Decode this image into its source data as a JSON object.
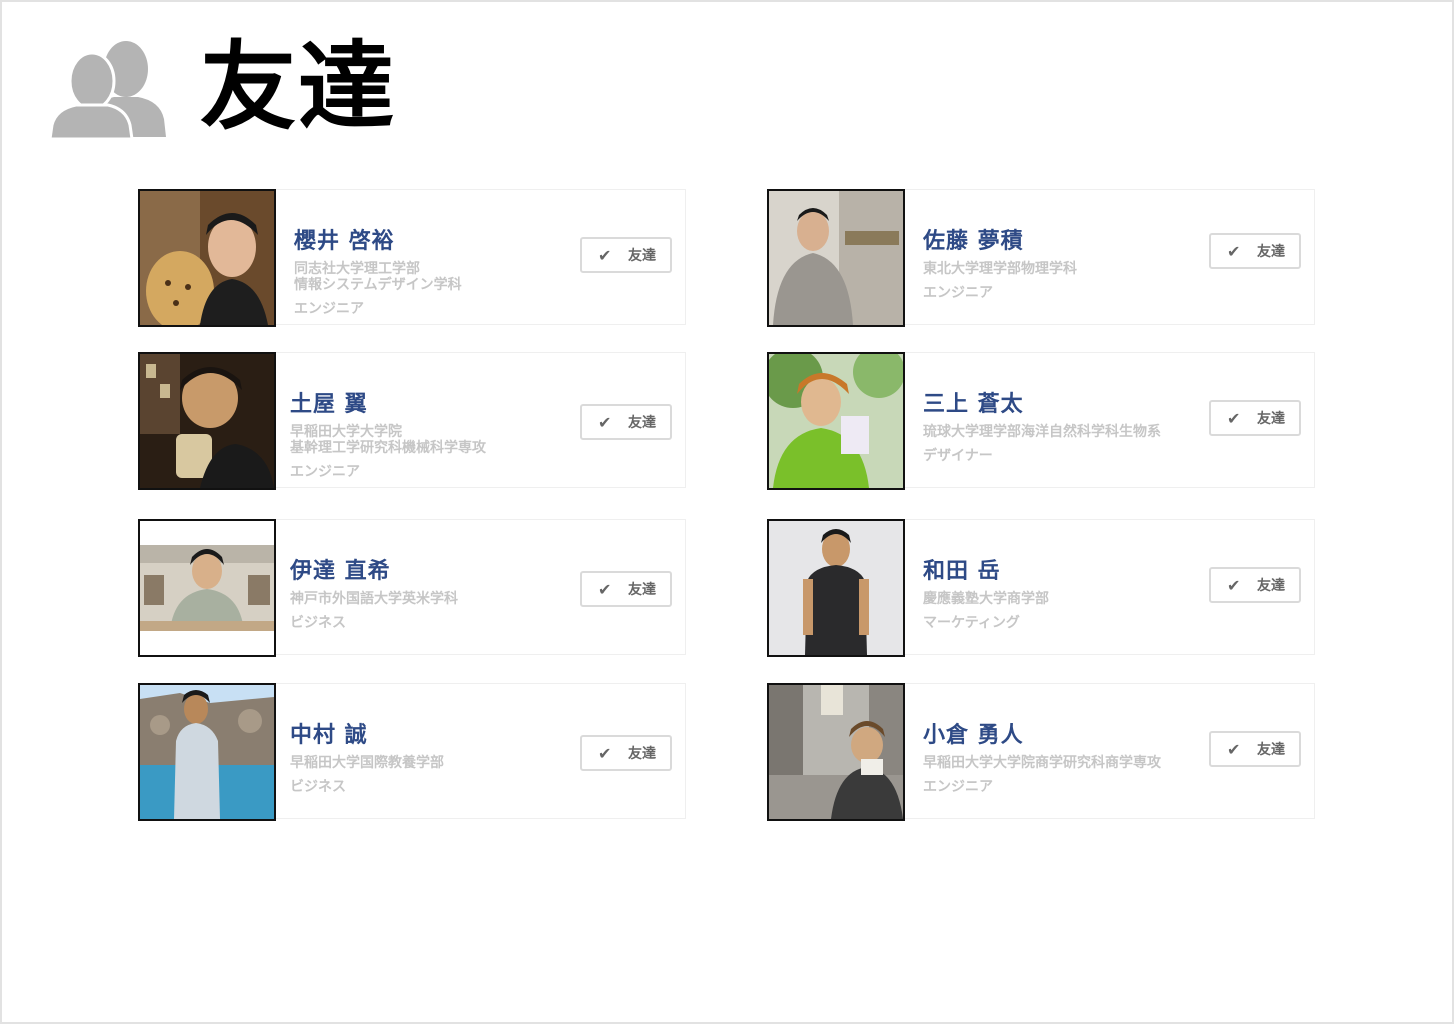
{
  "page": {
    "title": "友達",
    "icon": "people-icon"
  },
  "colors": {
    "name": "#2e4a86",
    "muted": "#c6c6c6",
    "button_border": "#dadada",
    "icon_gray": "#b4b4b4"
  },
  "friends": [
    {
      "name": "櫻井 啓裕",
      "school": [
        "同志社大学理工学部",
        "情報システムデザイン学科"
      ],
      "role": "エンジニア",
      "button_label": "友達",
      "button_icon": "check-icon"
    },
    {
      "name": "佐藤 夢積",
      "school": [
        "東北大学理学部物理学科"
      ],
      "role": "エンジニア",
      "button_label": "友達",
      "button_icon": "check-icon"
    },
    {
      "name": "土屋 翼",
      "school": [
        "早稲田大学大学院",
        "基幹理工学研究科機械科学専攻"
      ],
      "role": "エンジニア",
      "button_label": "友達",
      "button_icon": "check-icon"
    },
    {
      "name": "三上 蒼太",
      "school": [
        "琉球大学理学部海洋自然科学科生物系"
      ],
      "role": "デザイナー",
      "button_label": "友達",
      "button_icon": "check-icon"
    },
    {
      "name": "伊達 直希",
      "school": [
        "神戸市外国語大学英米学科"
      ],
      "role": "ビジネス",
      "button_label": "友達",
      "button_icon": "check-icon"
    },
    {
      "name": "和田 岳",
      "school": [
        "慶應義塾大学商学部"
      ],
      "role": "マーケティング",
      "button_label": "友達",
      "button_icon": "check-icon"
    },
    {
      "name": "中村 誠",
      "school": [
        "早稲田大学国際教養学部"
      ],
      "role": "ビジネス",
      "button_label": "友達",
      "button_icon": "check-icon"
    },
    {
      "name": "小倉 勇人",
      "school": [
        "早稲田大学大学院商学研究科商学専攻"
      ],
      "role": "エンジニア",
      "button_label": "友達",
      "button_icon": "check-icon"
    }
  ]
}
